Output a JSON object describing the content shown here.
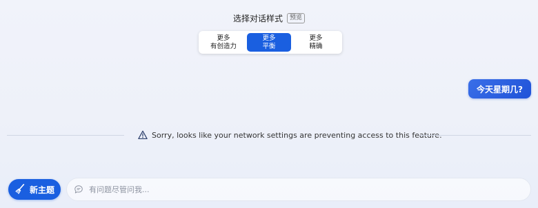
{
  "style_selector": {
    "title": "选择对话样式",
    "badge": "预览",
    "options": [
      {
        "line1": "更多",
        "line2": "有创造力",
        "active": false
      },
      {
        "line1": "更多",
        "line2": "平衡",
        "active": true
      },
      {
        "line1": "更多",
        "line2": "精确",
        "active": false
      }
    ]
  },
  "conversation": {
    "user_message": "今天星期几?"
  },
  "notice": {
    "text": "Sorry, looks like your network settings are preventing access to this feature.",
    "icon": "warning-icon"
  },
  "composer": {
    "new_topic_label": "新主题",
    "new_topic_icon": "broom-icon",
    "input_placeholder": "有问题尽管问我...",
    "input_value": "",
    "input_icon": "chat-bubble-icon"
  },
  "colors": {
    "accent": "#1a5fe0"
  }
}
